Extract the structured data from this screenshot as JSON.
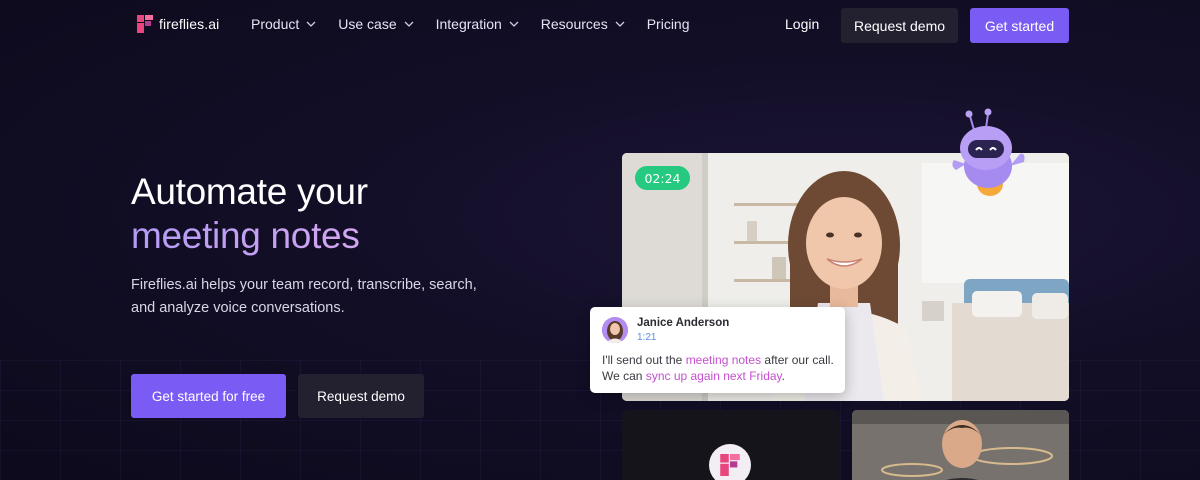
{
  "nav": {
    "logo_text": "fireflies.ai",
    "links": [
      {
        "label": "Product",
        "has_dropdown": true
      },
      {
        "label": "Use case",
        "has_dropdown": true
      },
      {
        "label": "Integration",
        "has_dropdown": true
      },
      {
        "label": "Resources",
        "has_dropdown": true
      },
      {
        "label": "Pricing",
        "has_dropdown": false
      }
    ],
    "login_label": "Login",
    "request_demo_label": "Request demo",
    "get_started_label": "Get started"
  },
  "hero": {
    "title_line1": "Automate your",
    "title_line2": "meeting notes",
    "subtitle": "Fireflies.ai helps your team record, transcribe, search, and analyze voice conversations.",
    "primary_cta": "Get started for free",
    "secondary_cta": "Request demo"
  },
  "video": {
    "timer": "02:24",
    "chat": {
      "name": "Janice Anderson",
      "time": "1:21",
      "msg_part1": "I'll send out the ",
      "msg_highlight1": "meeting notes",
      "msg_part2": " after our call. We can ",
      "msg_highlight2": "sync up again next Friday",
      "msg_part3": "."
    }
  },
  "colors": {
    "accent": "#7a5cf5",
    "background": "#120e26",
    "secondary_button": "#23202f",
    "timer_green": "#25c97f",
    "highlight_pink": "#c54fcf",
    "title_gradient_start": "#b49cf6",
    "title_gradient_end": "#d2a6f0"
  },
  "icons": {
    "logo": "fireflies-logo-icon",
    "dropdown": "chevron-down-icon",
    "mascot": "robot-mascot-icon"
  }
}
